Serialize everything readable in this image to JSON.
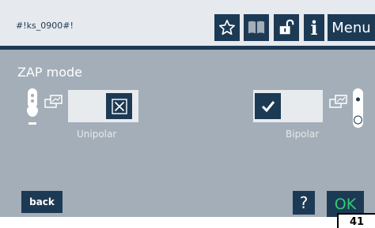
{
  "header": {
    "screen_id": "#!ks_0900#!",
    "menu_label": "Menu",
    "info_label": "i"
  },
  "main": {
    "title": "ZAP mode",
    "options": [
      {
        "label": "Unipolar",
        "checked": false
      },
      {
        "label": "Bipolar",
        "checked": true
      }
    ]
  },
  "footer": {
    "back_label": "back",
    "help_label": "?",
    "ok_label": "OK"
  },
  "page_tab": {
    "label": "41"
  },
  "icons": {
    "favorite": "star-outline-icon",
    "book": "book-icon",
    "lock": "padlock-open-icon",
    "info": "info-icon",
    "unipolar_device": "unipolar-electrode-icon",
    "bipolar_device": "bipolar-electrode-icon",
    "unchecked": "cross-box-icon",
    "checked": "checkmark-icon"
  },
  "colors": {
    "background": "#a3aeb8",
    "header": "#e6e9ed",
    "accent": "#1d3a55",
    "ok_text": "#2ecc71"
  }
}
